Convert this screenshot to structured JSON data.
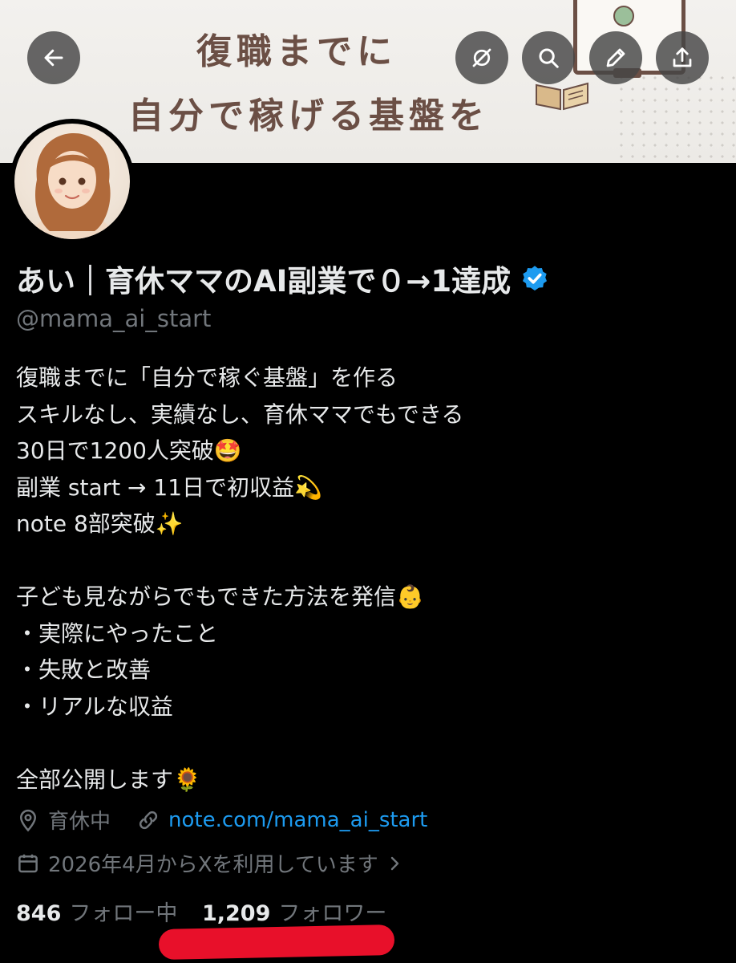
{
  "banner": {
    "line1": "復職までに",
    "line2": "自分で稼げる基盤を"
  },
  "toolbar": {
    "back_icon": "arrow-left-icon",
    "icons": [
      "grok-icon",
      "search-icon",
      "pencil-icon",
      "share-icon"
    ]
  },
  "profile": {
    "display_name": "あい｜育休ママのAI副業で０→1達成",
    "verified": true,
    "handle": "@mama_ai_start",
    "bio_lines": [
      "復職までに「自分で稼ぐ基盤」を作る",
      "スキルなし、実績なし、育休ママでもできる",
      "30日で1200人突破🤩",
      "副業 start → 11日で初収益💫",
      "note 8部突破✨",
      "",
      "子ども見ながらでもできた方法を発信👶",
      "・実際にやったこと",
      "・失敗と改善",
      "・リアルな収益",
      "",
      "全部公開します🌻"
    ],
    "location": "育休中",
    "website": "note.com/mama_ai_start",
    "joined": "2026年4月からXを利用しています",
    "following_count": "846",
    "following_label": "フォロー中",
    "followers_count": "1,209",
    "followers_label": "フォロワー"
  },
  "colors": {
    "accent": "#1d9bf0",
    "muted": "#71767b",
    "text": "#e7e9ea",
    "annotation_red": "#e8102a"
  }
}
